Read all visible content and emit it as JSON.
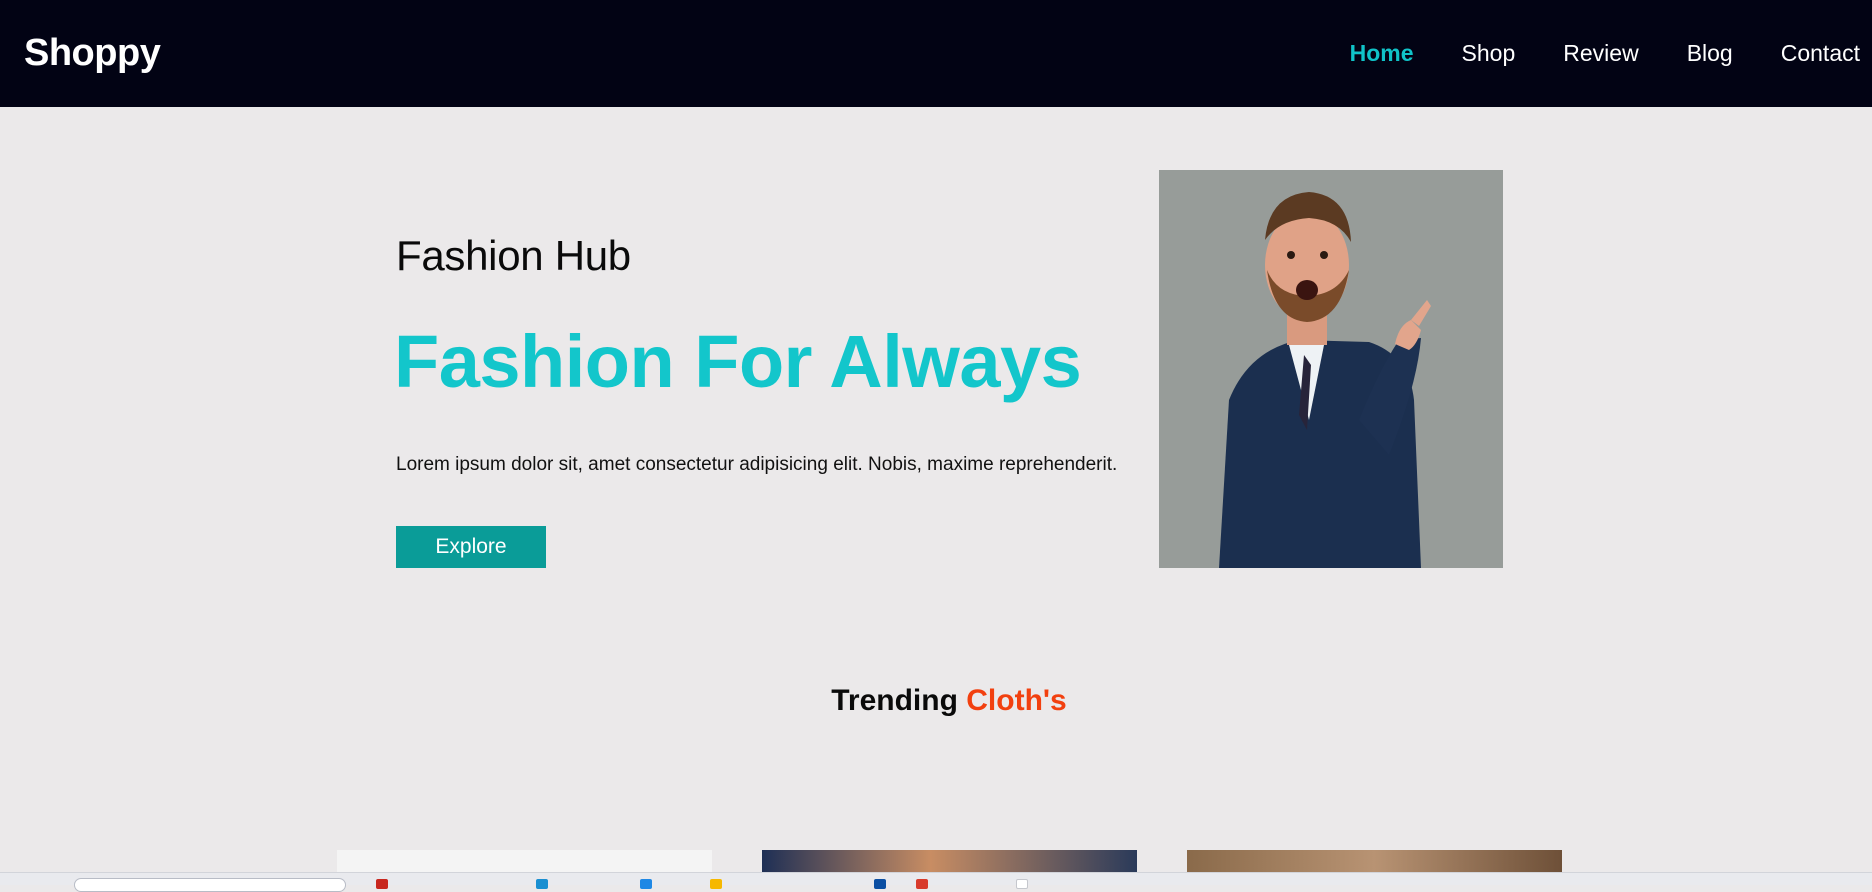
{
  "header": {
    "brand": "Shoppy",
    "nav": [
      {
        "label": "Home",
        "active": true
      },
      {
        "label": "Shop",
        "active": false
      },
      {
        "label": "Review",
        "active": false
      },
      {
        "label": "Blog",
        "active": false
      },
      {
        "label": "Contact",
        "active": false
      }
    ]
  },
  "hero": {
    "kicker": "Fashion Hub",
    "title": "Fashion For Always",
    "description": "Lorem ipsum dolor sit, amet consectetur adipisicing elit. Nobis, maxime reprehenderit.",
    "button_label": "Explore",
    "image_icon": "man-in-suit-pointing-photo"
  },
  "trending": {
    "title_main": "Trending",
    "title_accent": "Cloth's",
    "cards": [
      {
        "image_icon": "product-photo"
      },
      {
        "image_icon": "product-photo"
      },
      {
        "image_icon": "product-photo"
      }
    ]
  },
  "colors": {
    "header_bg": "#020314",
    "accent_teal": "#13c6cb",
    "button_bg": "#0a9c98",
    "accent_orange": "#f2400f",
    "page_bg": "#ebe9ea"
  }
}
